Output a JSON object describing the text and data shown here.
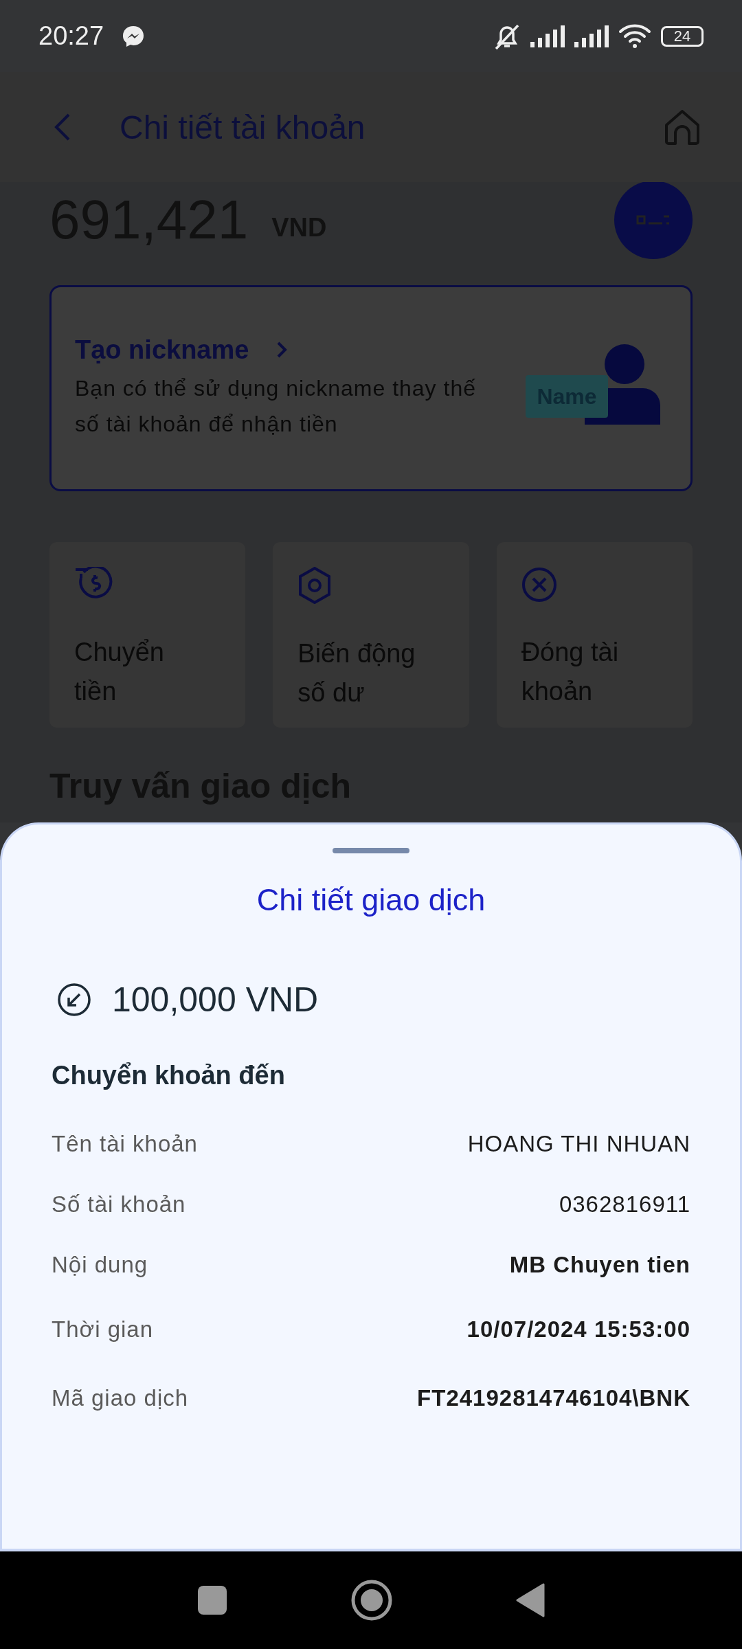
{
  "status_bar": {
    "time": "20:27",
    "battery": "24"
  },
  "header": {
    "title": "Chi tiết tài khoản"
  },
  "balance": {
    "amount": "691,421",
    "currency": "VND"
  },
  "nickname_card": {
    "title": "Tạo nickname",
    "description": "Bạn có thể sử dụng nickname thay thế số tài khoản để nhận tiền",
    "badge": "Name"
  },
  "actions": [
    {
      "kind": "transfer",
      "label": "Chuyển tiền"
    },
    {
      "kind": "balance",
      "label": "Biến động số dư"
    },
    {
      "kind": "close",
      "label": "Đóng tài khoản"
    }
  ],
  "section_title": "Truy vấn giao dịch",
  "sheet": {
    "title": "Chi tiết giao dịch",
    "amount": "100,000 VND",
    "type": "Chuyển khoản đến",
    "rows": [
      {
        "label": "Tên tài khoản",
        "value": "HOANG THI NHUAN",
        "bold": false
      },
      {
        "label": "Số tài khoản",
        "value": "0362816911",
        "bold": false
      },
      {
        "label": "Nội dung",
        "value": "MB Chuyen tien",
        "bold": true
      },
      {
        "label": "Thời gian",
        "value": "10/07/2024 15:53:00",
        "bold": true
      },
      {
        "label": "Mã giao dịch",
        "value": "FT24192814746104\\BNK",
        "bold": true
      }
    ]
  }
}
